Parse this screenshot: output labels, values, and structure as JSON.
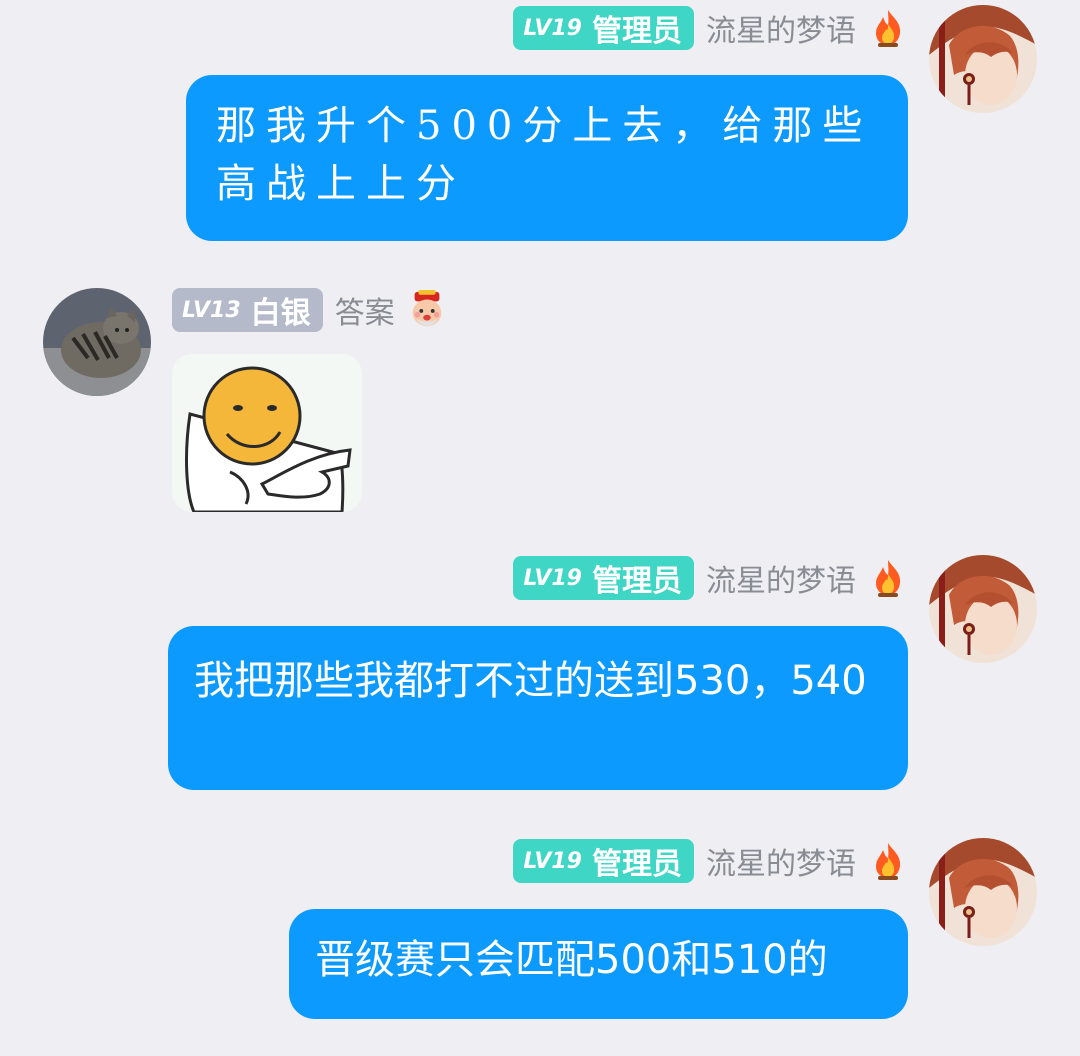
{
  "messages": [
    {
      "sender_level": "LV19",
      "sender_role": "管理员",
      "sender_name": "流星的梦语",
      "medal": "fire-icon",
      "text": "那我升个500分上去，给那些高战上上分"
    },
    {
      "sender_level": "LV13",
      "sender_role": "白银",
      "sender_name": "答案",
      "medal": "god-of-wealth-icon",
      "sticker": "pointing-smiley-sticker"
    },
    {
      "sender_level": "LV19",
      "sender_role": "管理员",
      "sender_name": "流星的梦语",
      "medal": "fire-icon",
      "text": "我把那些我都打不过的送到530，540"
    },
    {
      "sender_level": "LV19",
      "sender_role": "管理员",
      "sender_name": "流星的梦语",
      "medal": "fire-icon",
      "text": "晋级赛只会匹配500和510的"
    }
  ],
  "colors": {
    "background": "#eeeef3",
    "bubble": "#0c9aff",
    "admin_badge": "#3fd6c6",
    "silver_badge": "#b5bacb",
    "username": "#8a8c94"
  }
}
